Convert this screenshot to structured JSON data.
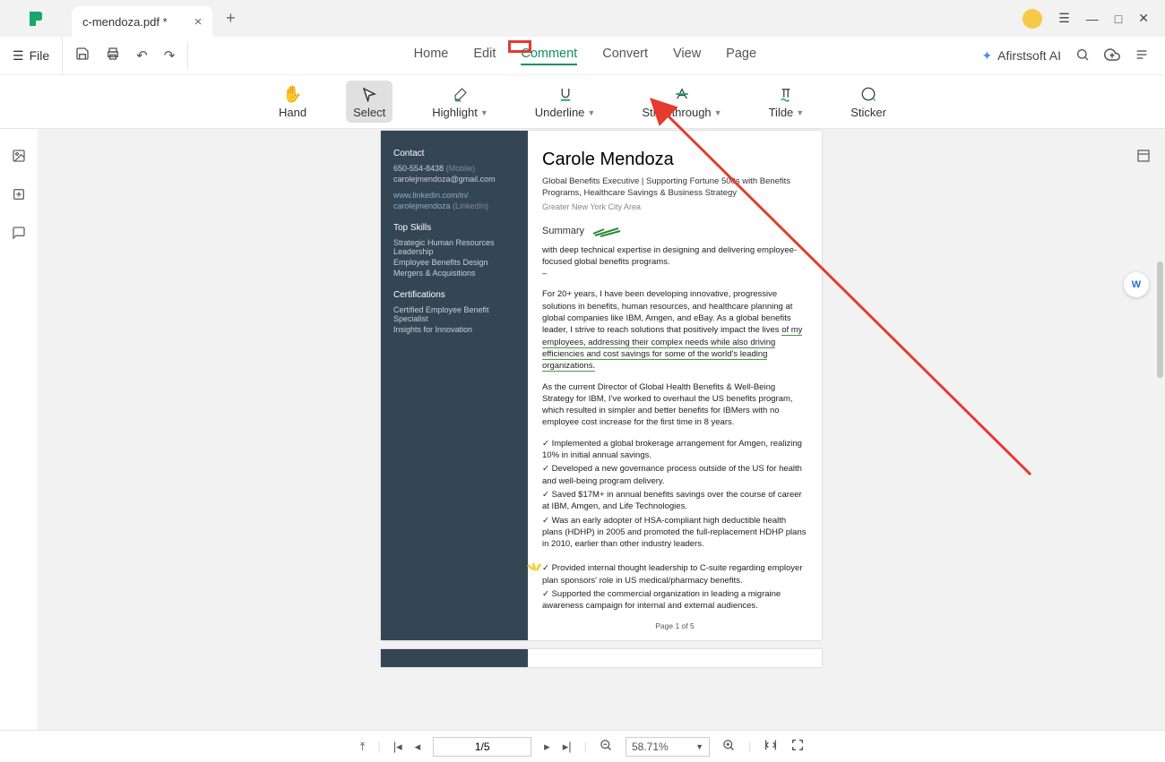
{
  "tab": {
    "title": "c-mendoza.pdf *"
  },
  "file_label": "File",
  "maintabs": {
    "home": "Home",
    "edit": "Edit",
    "comment": "Comment",
    "convert": "Convert",
    "view": "View",
    "page": "Page"
  },
  "ai_label": "Afirstsoft AI",
  "tools": {
    "hand": "Hand",
    "select": "Select",
    "highlight": "Highlight",
    "underline": "Underline",
    "strikethrough": "Strikethrough",
    "tilde": "Tilde",
    "sticker": "Sticker"
  },
  "doc": {
    "sidebar": {
      "contact_h": "Contact",
      "phone": "650-554-8438",
      "phone_note": "(Mobile)",
      "email": "carolejmendoza@gmail.com",
      "linkedin_url": "www.linkedin.com/in/",
      "linkedin_handle": "carolejmendoza",
      "linkedin_note": "(LinkedIn)",
      "skills_h": "Top Skills",
      "skills": [
        "Strategic Human Resources Leadership",
        "Employee Benefits Design",
        "Mergers & Acquisitions"
      ],
      "certs_h": "Certifications",
      "certs": [
        "Certified Employee Benefit Specialist",
        "Insights for Innovation"
      ]
    },
    "name": "Carole Mendoza",
    "subtitle": "Global Benefits Executive | Supporting Fortune 500s with Benefits Programs, Healthcare Savings & Business Strategy",
    "location": "Greater New York City Area",
    "summary_h": "Summary",
    "summary_p1": "with deep technical expertise in designing and delivering employee-focused global benefits programs.",
    "summary_dash": "–",
    "p2_a": "For 20+ years, I have been developing innovative, progressive solutions in benefits, human resources, and healthcare planning at global companies like IBM, Amgen, and eBay. As a global benefits leader, I strive to reach solutions that positively impact the lives ",
    "p2_u": "of my employees, addressing their complex needs while also driving efficiencies and cost savings for some of the world's leading organizations.",
    "p3": "As the current Director of Global Health Benefits & Well-Being Strategy for IBM, I've worked to overhaul the US benefits program, which resulted in simpler and better benefits for IBMers with no employee cost increase for the first time in 8 years.",
    "b1": "✓ Implemented a global brokerage arrangement for Amgen, realizing 10% in initial annual savings.",
    "b2": "✓ Developed a new governance process outside of the US for health and well-being program delivery.",
    "b3": "✓ Saved $17M+ in annual benefits savings over the course of career at IBM, Amgen, and Life Technologies.",
    "b4": "✓ Was an early adopter of HSA-compliant high deductible health plans (HDHP) in 2005 and promoted the full-replacement HDHP plans in 2010, earlier than other industry leaders.",
    "b5": "✓ Provided internal thought leadership to C-suite regarding employer plan sponsors' role in US medical/pharmacy benefits.",
    "b6": "✓ Supported the commercial organization in leading a migraine awareness campaign for internal and external audiences.",
    "pagenum": "Page 1 of 5"
  },
  "bottom": {
    "pages": "1/5",
    "zoom": "58.71%"
  }
}
